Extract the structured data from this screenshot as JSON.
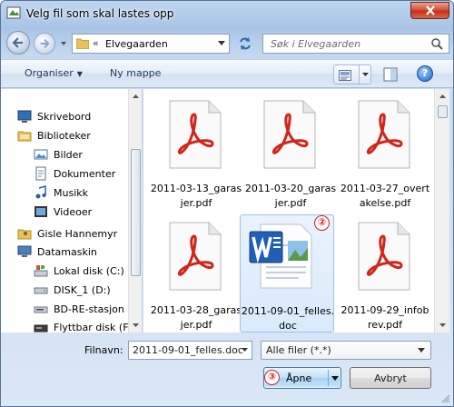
{
  "window": {
    "title": "Velg fil som skal lastes opp",
    "close_label": "×"
  },
  "address": {
    "separator": "«",
    "path": "Elvegaarden"
  },
  "search": {
    "placeholder": "Søk i Elvegaarden"
  },
  "toolbar": {
    "organise": "Organiser",
    "new_folder": "Ny mappe",
    "help": "?"
  },
  "nav": {
    "items": [
      {
        "label": "Skrivebord",
        "icon": "desktop-icon"
      },
      {
        "label": "Biblioteker",
        "icon": "library-icon"
      },
      {
        "label": "Bilder",
        "icon": "pictures-icon"
      },
      {
        "label": "Dokumenter",
        "icon": "documents-icon"
      },
      {
        "label": "Musikk",
        "icon": "music-icon"
      },
      {
        "label": "Videoer",
        "icon": "videos-icon"
      },
      {
        "label": "Gisle Hannemyr",
        "icon": "user-folder-icon"
      },
      {
        "label": "Datamaskin",
        "icon": "computer-icon"
      },
      {
        "label": "Lokal disk (C:)",
        "icon": "local-disk-icon"
      },
      {
        "label": "DISK_1 (D:)",
        "icon": "drive-icon"
      },
      {
        "label": "BD-RE-stasjon",
        "icon": "optical-drive-icon"
      },
      {
        "label": "Flyttbar disk (F:",
        "icon": "removable-disk-icon"
      }
    ]
  },
  "files": [
    {
      "line1": "2011-03-13_garas",
      "line2": "jer.pdf",
      "type": "pdf"
    },
    {
      "line1": "2011-03-20_garas",
      "line2": "jer.pdf",
      "type": "pdf"
    },
    {
      "line1": "2011-03-27_overt",
      "line2": "akelse.pdf",
      "type": "pdf"
    },
    {
      "line1": "2011-03-28_garas",
      "line2": "jer.pdf",
      "type": "pdf"
    },
    {
      "line1": "2011-09-01_felles.",
      "line2": "doc",
      "type": "doc",
      "selected": true
    },
    {
      "line1": "2011-09-29_infob",
      "line2": "rev.pdf",
      "type": "pdf"
    }
  ],
  "callouts": {
    "selected_file": "②",
    "open": "③"
  },
  "filename": {
    "label": "Filnavn:",
    "value": "2011-09-01_felles.doc"
  },
  "filter": {
    "value": "Alle filer (*.*)"
  },
  "buttons": {
    "open": "Åpne",
    "cancel": "Avbryt"
  },
  "colors": {
    "accent": "#3c7fb1",
    "selection": "#d9eafc",
    "pdf_red": "#d0251b",
    "callout_red": "#d42020"
  }
}
